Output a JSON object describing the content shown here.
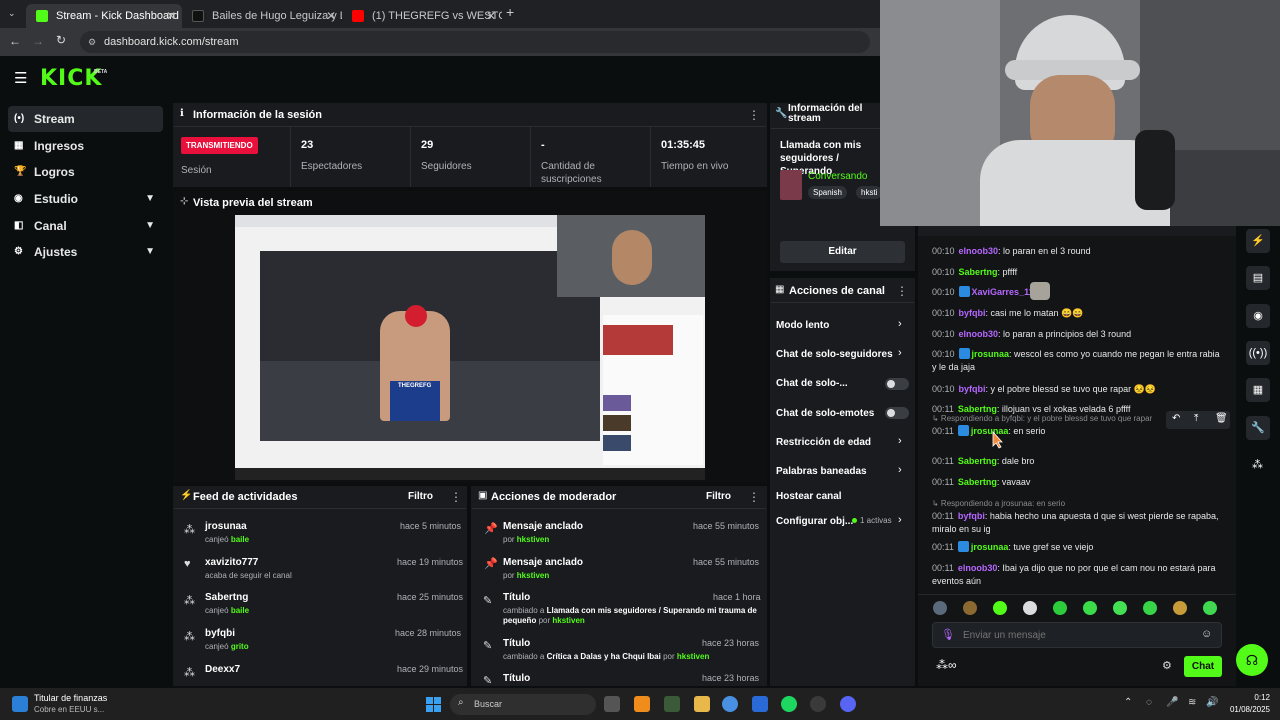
{
  "browser": {
    "tabs": [
      {
        "title": "Stream - Kick Dashboard",
        "active": true
      },
      {
        "title": "Bailes de Hugo Leguiza y Luis I",
        "active": false
      },
      {
        "title": "(1) THEGREFG vs WESTCOL | LA",
        "active": false
      }
    ],
    "url": "dashboard.kick.com/stream"
  },
  "brand": {
    "logo": "KICK",
    "beta": "BETA",
    "accent": "#53fc18"
  },
  "sidebar": {
    "items": [
      {
        "label": "Stream",
        "icon": "stream-icon",
        "active": true
      },
      {
        "label": "Ingresos",
        "icon": "money-icon",
        "expand": false
      },
      {
        "label": "Logros",
        "icon": "trophy-icon",
        "expand": false
      },
      {
        "label": "Estudio",
        "icon": "studio-icon",
        "expand": true
      },
      {
        "label": "Canal",
        "icon": "channel-icon",
        "expand": true
      },
      {
        "label": "Ajustes",
        "icon": "gear-icon",
        "expand": true
      }
    ]
  },
  "session": {
    "title": "Información de la sesión",
    "status": "TRANSMITIENDO",
    "status_label": "Sesión",
    "stats": [
      {
        "value": "23",
        "label": "Espectadores"
      },
      {
        "value": "29",
        "label": "Seguidores"
      },
      {
        "value": "-",
        "label": "Cantidad de suscripciones"
      },
      {
        "value": "01:35:45",
        "label": "Tiempo en vivo"
      }
    ]
  },
  "preview": {
    "title": "Vista previa del stream",
    "overlay_text": "THEGREFG"
  },
  "stream_info": {
    "title": "Información del stream",
    "stream_title": "Llamada con mis seguidores / Superando",
    "category": "Conversando",
    "tags": [
      "Spanish",
      "hksti"
    ],
    "edit_label": "Editar"
  },
  "channel_actions": {
    "title": "Acciones de canal",
    "items": [
      {
        "label": "Modo lento",
        "control": "chevron"
      },
      {
        "label": "Chat de solo-seguidores",
        "control": "chevron"
      },
      {
        "label": "Chat de solo-...",
        "control": "toggle"
      },
      {
        "label": "Chat de solo-emotes",
        "control": "toggle"
      },
      {
        "label": "Restricción de edad",
        "control": "chevron"
      },
      {
        "label": "Palabras baneadas",
        "control": "chevron"
      },
      {
        "label": "Hostear canal",
        "control": "none"
      },
      {
        "label": "Configurar obj...",
        "control": "chevron",
        "extra": "1 activas"
      }
    ]
  },
  "activity_feed": {
    "title": "Feed de actividades",
    "filter": "Filtro",
    "items": [
      {
        "name": "jrosunaa",
        "action": "canjeó",
        "highlight": "baile",
        "time": "hace 5 minutos",
        "icon": "redeem-icon"
      },
      {
        "name": "xavizito777",
        "action": "acaba de seguir el canal",
        "highlight": "",
        "time": "hace 19 minutos",
        "icon": "heart-icon"
      },
      {
        "name": "Sabertng",
        "action": "canjeó",
        "highlight": "baile",
        "time": "hace 25 minutos",
        "icon": "redeem-icon"
      },
      {
        "name": "byfqbi",
        "action": "canjeó",
        "highlight": "grito",
        "time": "hace 28 minutos",
        "icon": "redeem-icon"
      },
      {
        "name": "Deexx7",
        "action": "",
        "highlight": "",
        "time": "hace 29 minutos",
        "icon": "redeem-icon"
      }
    ]
  },
  "mod_actions": {
    "title": "Acciones de moderador",
    "filter": "Filtro",
    "items": [
      {
        "name": "Mensaje anclado",
        "pre": "por",
        "by": "hkstiven",
        "detail": "",
        "time": "hace 55 minutos",
        "icon": "pin-icon"
      },
      {
        "name": "Mensaje anclado",
        "pre": "por",
        "by": "hkstiven",
        "detail": "",
        "time": "hace 55 minutos",
        "icon": "pin-icon"
      },
      {
        "name": "Título",
        "pre": "cambiado a",
        "by": "hkstiven",
        "detail": "Llamada con mis seguidores / Superando mi trauma de pequeño",
        "time": "hace 1 hora",
        "icon": "edit-icon"
      },
      {
        "name": "Título",
        "pre": "cambiado a",
        "by": "hkstiven",
        "detail": "Crítica a Dalas y ha Chqui Ibai",
        "time": "hace 23 horas",
        "icon": "edit-icon"
      },
      {
        "name": "Título",
        "pre": "",
        "by": "",
        "detail": "",
        "time": "hace 23 horas",
        "icon": "edit-icon"
      }
    ]
  },
  "chat": {
    "messages": [
      {
        "time": "00:10",
        "user": "elnoob30",
        "color": "#b667ff",
        "badge": false,
        "text": "lo paran en el 3 round"
      },
      {
        "time": "00:10",
        "user": "Sabertng",
        "color": "#53fc18",
        "badge": false,
        "text": "pffff"
      },
      {
        "time": "00:10",
        "user": "XaviGarres_11",
        "color": "#b667ff",
        "badge": true,
        "text": ""
      },
      {
        "time": "00:10",
        "user": "byfqbi",
        "color": "#b667ff",
        "badge": false,
        "text": "casi me lo matan 😄😄"
      },
      {
        "time": "00:10",
        "user": "elnoob30",
        "color": "#b667ff",
        "badge": false,
        "text": "lo paran a principios del 3 round"
      },
      {
        "time": "00:10",
        "user": "jrosunaa",
        "color": "#53fc18",
        "badge": true,
        "text": "wescol es como yo cuando me pegan le entra rabia y le da jaja"
      },
      {
        "time": "00:10",
        "user": "byfqbi",
        "color": "#b667ff",
        "badge": false,
        "text": "y el pobre blessd se tuvo que rapar 😣😣"
      },
      {
        "time": "00:11",
        "user": "Sabertng",
        "color": "#53fc18",
        "badge": false,
        "text": "illojuan vs el xokas velada 6 pffff"
      },
      {
        "time": "00:11",
        "user": "jrosunaa",
        "color": "#53fc18",
        "badge": true,
        "text": "en serio",
        "reply": "Respondiendo a byfqbi: y el pobre blessd se tuvo que rapar"
      },
      {
        "time": "00:11",
        "user": "Sabertng",
        "color": "#53fc18",
        "badge": false,
        "text": "dale bro"
      },
      {
        "time": "00:11",
        "user": "Sabertng",
        "color": "#53fc18",
        "badge": false,
        "text": "vavaav"
      },
      {
        "time": "00:11",
        "user": "byfqbi",
        "color": "#b667ff",
        "badge": false,
        "text": "habia hecho una apuesta d que si west pierde se rapaba, miralo en su ig",
        "reply": "Respondiendo a jrosunaa: en serio"
      },
      {
        "time": "00:11",
        "user": "jrosunaa",
        "color": "#53fc18",
        "badge": true,
        "text": "tuve gref se ve viejo"
      },
      {
        "time": "00:11",
        "user": "elnoob30",
        "color": "#b667ff",
        "badge": false,
        "text": "Ibai ya dijo que no por que el cam nou no estará para eventos aún"
      }
    ],
    "input_placeholder": "Enviar un mensaje",
    "send_label": "Chat"
  },
  "taskbar": {
    "widget_title": "Titular de finanzas",
    "widget_sub": "Cobre en EEUU s...",
    "search_placeholder": "Buscar",
    "time": "0:12",
    "date": "01/08/2025"
  }
}
